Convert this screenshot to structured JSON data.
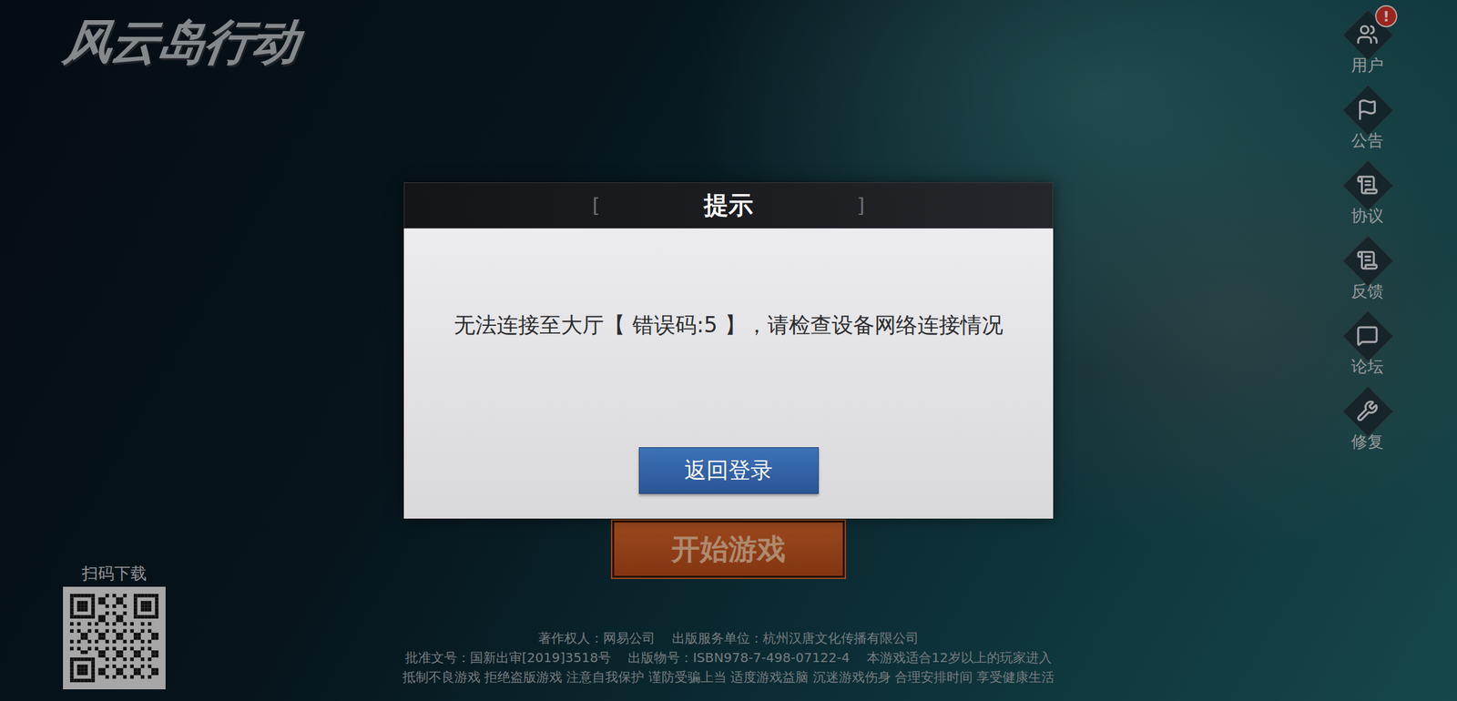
{
  "logo": "风云岛行动",
  "side_menu": [
    {
      "label": "用户",
      "badge": "!"
    },
    {
      "label": "公告"
    },
    {
      "label": "协议"
    },
    {
      "label": "反馈"
    },
    {
      "label": "论坛"
    },
    {
      "label": "修复"
    }
  ],
  "dialog": {
    "title": "提示",
    "bracket_left": "[",
    "bracket_right": "]",
    "message": "无法连接至大厅【 错误码:5 】，请检查设备网络连接情况",
    "button": "返回登录"
  },
  "start_button": {
    "label": "开始游戏"
  },
  "qr": {
    "label": "扫码下载"
  },
  "footer": [
    [
      "著作权人：网易公司",
      "出版服务单位：杭州汉唐文化传播有限公司"
    ],
    [
      "批准文号：国新出审[2019]3518号",
      "出版物号：ISBN978-7-498-07122-4",
      "本游戏适合12岁以上的玩家进入"
    ],
    [
      "抵制不良游戏 拒绝盗版游戏 注意自我保护 谨防受骗上当 适度游戏益脑 沉迷游戏伤身 合理安排时间 享受健康生活"
    ]
  ]
}
